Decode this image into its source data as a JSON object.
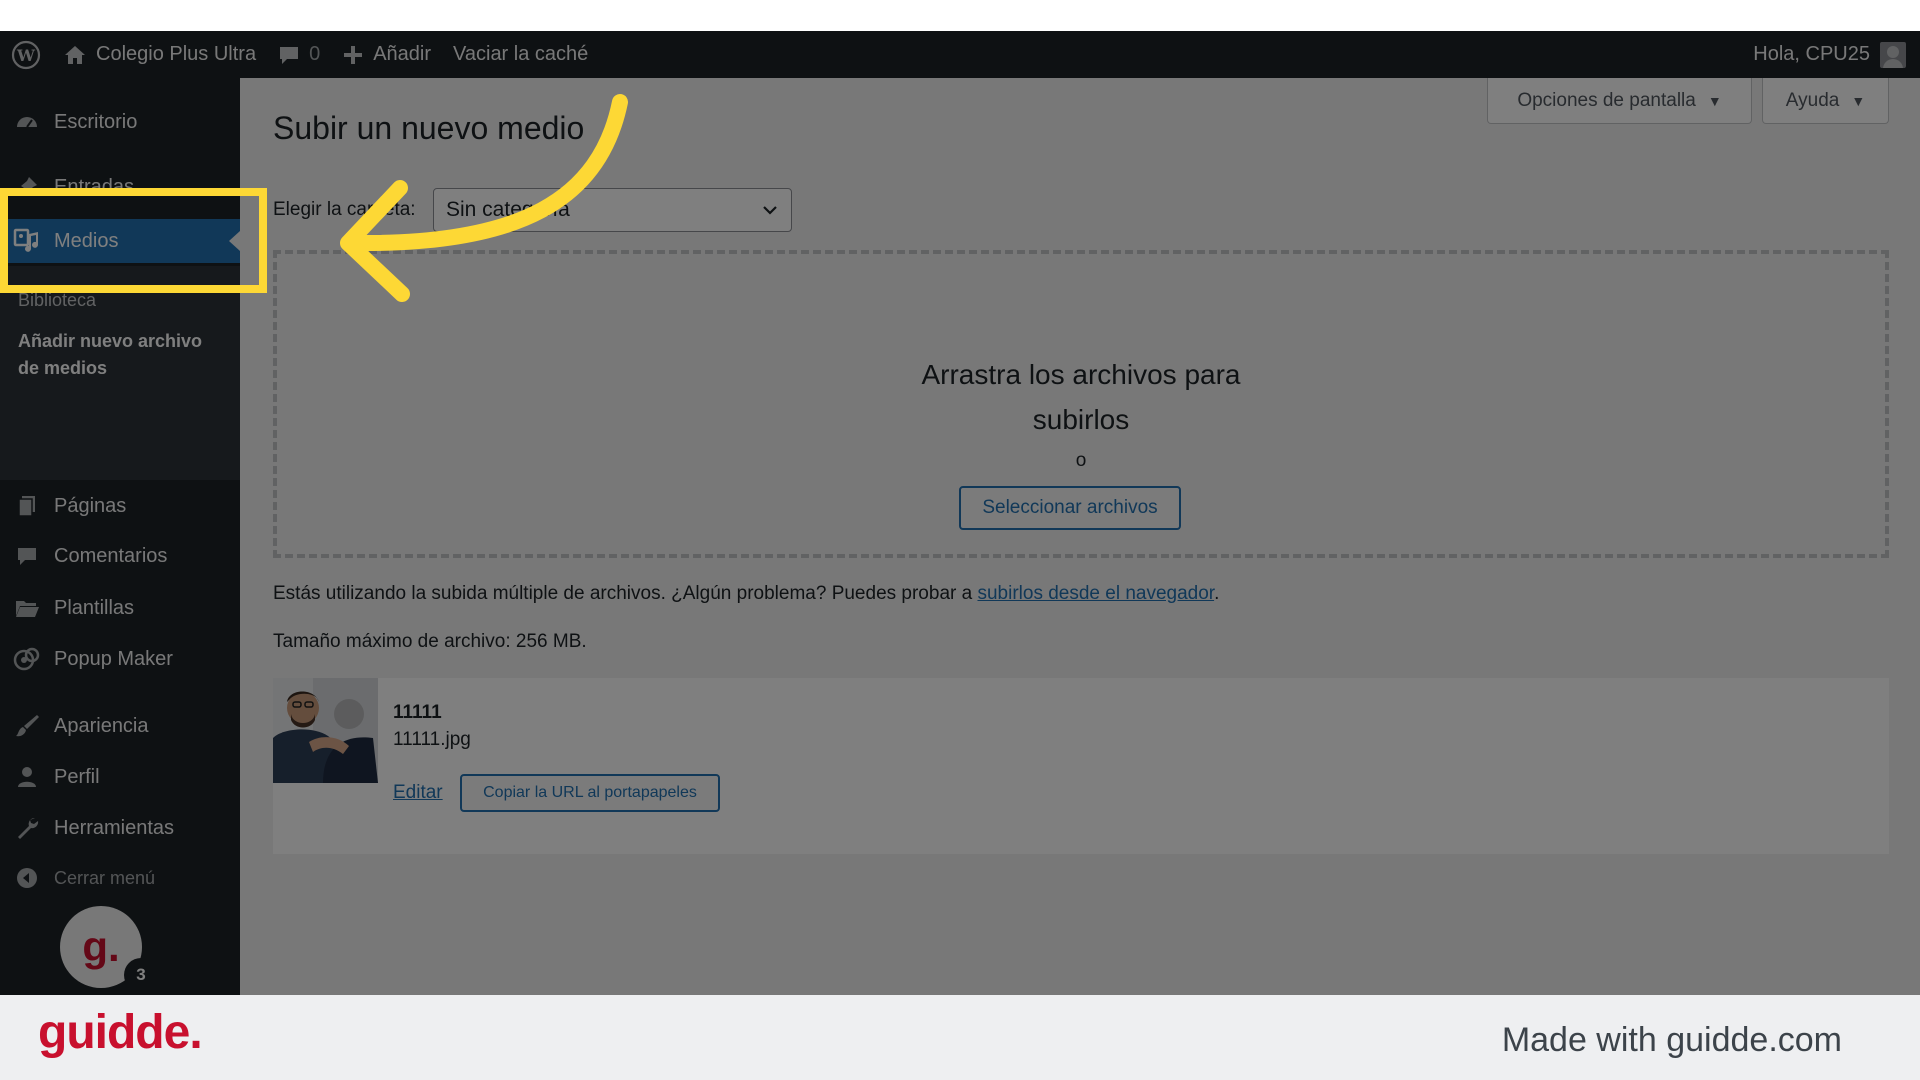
{
  "admin_bar": {
    "site_name": "Colegio Plus Ultra",
    "comments_count": "0",
    "add_new": "Añadir",
    "clear_cache": "Vaciar la caché",
    "howdy": "Hola, CPU25"
  },
  "sidebar": {
    "items": [
      {
        "label": "Escritorio",
        "icon": "dashboard-icon"
      },
      {
        "label": "Entradas",
        "icon": "pin-icon"
      },
      {
        "label": "Medios",
        "icon": "media-icon"
      },
      {
        "label": "Páginas",
        "icon": "pages-icon"
      },
      {
        "label": "Comentarios",
        "icon": "comment-icon"
      },
      {
        "label": "Plantillas",
        "icon": "folder-icon"
      },
      {
        "label": "Popup Maker",
        "icon": "popup-icon"
      },
      {
        "label": "Apariencia",
        "icon": "brush-icon"
      },
      {
        "label": "Perfil",
        "icon": "user-icon"
      },
      {
        "label": "Herramientas",
        "icon": "wrench-icon"
      },
      {
        "label": "Cerrar menú",
        "icon": "collapse-icon"
      }
    ],
    "submenu": {
      "library": "Biblioteca",
      "add_new": "Añadir nuevo archivo de medios"
    },
    "badge_count": "3",
    "avatar_letter": "g."
  },
  "header": {
    "screen_options": "Opciones de pantalla",
    "help": "Ayuda"
  },
  "main": {
    "title": "Subir un nuevo medio",
    "folder_label": "Elegir la carpeta:",
    "folder_value": "Sin categoría",
    "drop_instructions": "Arrastra los archivos para subirlos",
    "or": "o",
    "select_files": "Seleccionar archivos",
    "multi_upload_text": "Estás utilizando la subida múltiple de archivos. ¿Algún problema? Puedes probar a ",
    "browser_link": "subirlos desde el navegador",
    "period": ".",
    "max_size": "Tamaño máximo de archivo: 256 MB."
  },
  "upload_item": {
    "title": "11111",
    "filename": "11111.jpg",
    "edit": "Editar",
    "copy_url": "Copiar la URL al portapapeles"
  },
  "footer": {
    "logo": "guidde.",
    "made_with": "Made with guidde.com"
  },
  "colors": {
    "admin_bg": "#1d2327",
    "accent": "#2271b1",
    "highlight": "#fdd835",
    "brand": "#c8102e"
  }
}
